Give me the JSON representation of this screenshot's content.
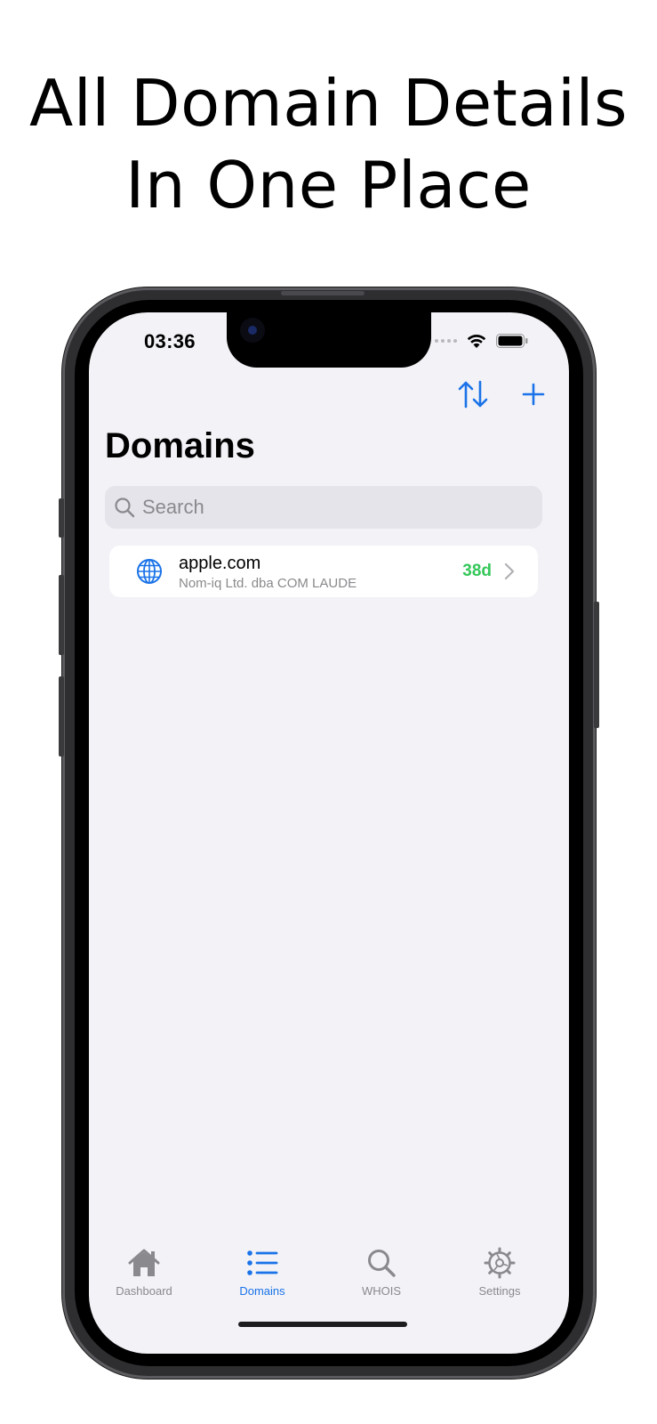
{
  "headline": {
    "line1": "All Domain Details",
    "line2": "In One Place"
  },
  "status_bar": {
    "time": "03:36"
  },
  "nav": {
    "sort_icon": "sort-arrows-icon",
    "add_icon": "plus-icon",
    "title": "Domains"
  },
  "search": {
    "placeholder": "Search",
    "icon": "magnifier-icon"
  },
  "domains": [
    {
      "name": "apple.com",
      "registrar": "Nom-iq Ltd. dba COM LAUDE",
      "expires_in": "38d",
      "icon": "globe-icon"
    }
  ],
  "tabs": [
    {
      "label": "Dashboard",
      "icon": "house-icon",
      "active": false
    },
    {
      "label": "Domains",
      "icon": "list-icon",
      "active": true
    },
    {
      "label": "WHOIS",
      "icon": "magnifier-icon",
      "active": false
    },
    {
      "label": "Settings",
      "icon": "gear-icon",
      "active": false
    }
  ],
  "colors": {
    "accent": "#1a73e8",
    "expiry_ok": "#34c759",
    "screen_bg": "#f2f2f7"
  }
}
